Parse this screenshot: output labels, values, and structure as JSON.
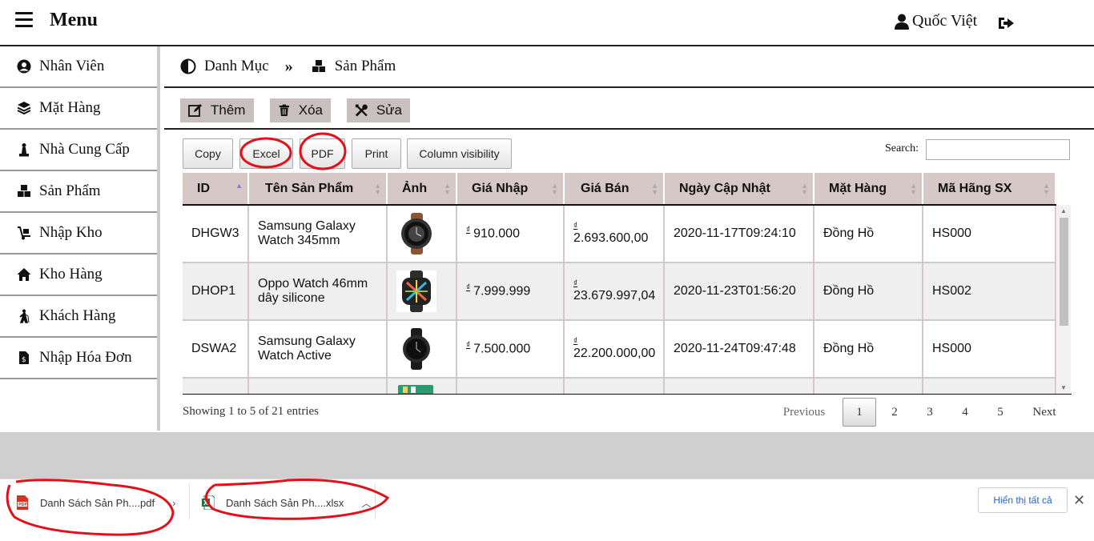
{
  "header": {
    "menu_title": "Menu",
    "user_name": "Quốc Việt"
  },
  "sidebar": {
    "items": [
      {
        "label": "Nhân Viên",
        "icon": "user-circle-icon"
      },
      {
        "label": "Mặt Hàng",
        "icon": "layers-icon"
      },
      {
        "label": "Nhà Cung Cấp",
        "icon": "chess-pawn-icon"
      },
      {
        "label": "Sản Phẩm",
        "icon": "cubes-icon"
      },
      {
        "label": "Nhập Kho",
        "icon": "dolly-icon"
      },
      {
        "label": "Kho Hàng",
        "icon": "home-icon"
      },
      {
        "label": "Khách Hàng",
        "icon": "walking-person-icon"
      },
      {
        "label": "Nhập Hóa Đơn",
        "icon": "invoice-icon"
      }
    ]
  },
  "breadcrumb": {
    "parent": "Danh Mục",
    "current": "Sản Phẩm"
  },
  "actions": {
    "add": "Thêm",
    "delete": "Xóa",
    "edit": "Sửa"
  },
  "datatable": {
    "buttons": {
      "copy": "Copy",
      "excel": "Excel",
      "pdf": "PDF",
      "print": "Print",
      "colvis": "Column visibility"
    },
    "search_label": "Search:",
    "search_value": "",
    "columns": [
      "ID",
      "Tên Sản Phẩm",
      "Ảnh",
      "Giá Nhập",
      "Giá Bán",
      "Ngày Cập Nhật",
      "Mặt Hàng",
      "Mã Hãng SX"
    ],
    "currency_symbol": "₫",
    "rows": [
      {
        "id": "DHGW3",
        "name_line1": "Samsung Galaxy",
        "name_line2": "Watch 345mm",
        "image": "leather-smartwatch",
        "cost": "910.000",
        "price": "2.693.600,00",
        "updated": "2020-11-17T09:24:10",
        "category": "Đồng Hồ",
        "maker": "HS000"
      },
      {
        "id": "DHOP1",
        "name_line1": "Oppo Watch 46mm",
        "name_line2": "dây silicone",
        "image": "colorful-square-smartwatch",
        "cost": "7.999.999",
        "price": "23.679.997,04",
        "updated": "2020-11-23T01:56:20",
        "category": "Đồng Hồ",
        "maker": "HS002"
      },
      {
        "id": "DSWA2",
        "name_line1": "Samsung Galaxy",
        "name_line2": "Watch Active",
        "image": "black-round-smartwatch",
        "cost": "7.500.000",
        "price": "22.200.000,00",
        "updated": "2020-11-24T09:47:48",
        "category": "Đồng Hồ",
        "maker": "HS000"
      }
    ],
    "info": "Showing 1 to 5 of 21 entries",
    "pagination": {
      "previous": "Previous",
      "pages": [
        "1",
        "2",
        "3",
        "4",
        "5"
      ],
      "current": "1",
      "next": "Next"
    }
  },
  "downloads": {
    "items": [
      {
        "name": "Danh Sách Sản Ph....pdf",
        "type": "pdf-file-icon"
      },
      {
        "name": "Danh Sách Sản Ph....xlsx",
        "type": "excel-file-icon"
      }
    ],
    "show_all": "Hiển thị tất cả"
  },
  "colors": {
    "header_bg": "#d6c8c6",
    "action_btn_bg": "#c8c0be",
    "annotation_red": "#e3101a",
    "link_blue": "#1a66d2"
  }
}
